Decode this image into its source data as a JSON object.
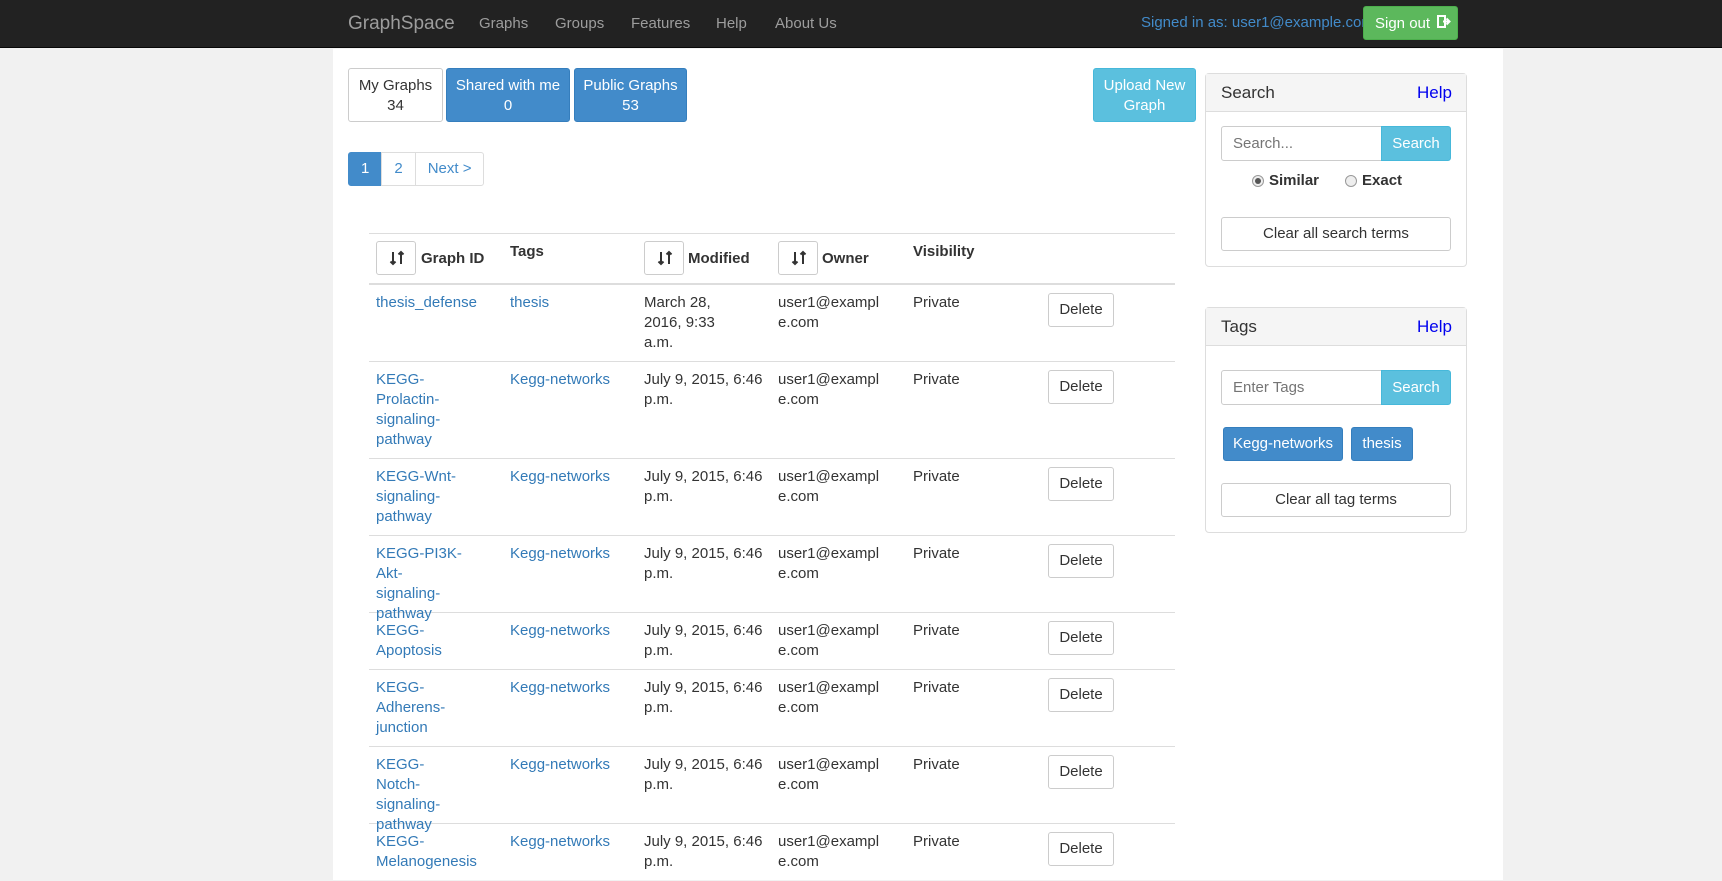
{
  "navbar": {
    "brand": "GraphSpace",
    "links": [
      "Graphs",
      "Groups",
      "Features",
      "Help",
      "About Us"
    ],
    "signed_in": "Signed in as: user1@example.com",
    "sign_out": "Sign out",
    "sign_out_icon": "sign-out-icon"
  },
  "tabs": {
    "my_graphs": {
      "label": "My Graphs",
      "count": "34"
    },
    "shared": {
      "label": "Shared with me",
      "count": "0"
    },
    "public": {
      "label": "Public Graphs",
      "count": "53"
    }
  },
  "upload": {
    "line1": "Upload New",
    "line2": "Graph"
  },
  "pagination": {
    "pages": [
      "1",
      "2"
    ],
    "next": "Next >",
    "active": "1"
  },
  "table": {
    "headers": {
      "graph_id": "Graph ID",
      "tags": "Tags",
      "modified": "Modified",
      "owner": "Owner",
      "visibility": "Visibility"
    },
    "sort_icon": "sort-icon",
    "rows": [
      {
        "graph_id": "thesis_defense",
        "tag": "thesis",
        "modified": "March 28, 2016, 9:33 a.m.",
        "owner": "user1@example.com",
        "visibility": "Private",
        "action": "Delete"
      },
      {
        "graph_id": "KEGG-Prolactin-signaling-pathway",
        "tag": "Kegg-networks",
        "modified": "July 9, 2015, 6:46 p.m.",
        "owner": "user1@example.com",
        "visibility": "Private",
        "action": "Delete"
      },
      {
        "graph_id": "KEGG-Wnt-signaling-pathway",
        "tag": "Kegg-networks",
        "modified": "July 9, 2015, 6:46 p.m.",
        "owner": "user1@example.com",
        "visibility": "Private",
        "action": "Delete"
      },
      {
        "graph_id": "KEGG-PI3K-Akt-signaling-pathway",
        "tag": "Kegg-networks",
        "modified": "July 9, 2015, 6:46 p.m.",
        "owner": "user1@example.com",
        "visibility": "Private",
        "action": "Delete"
      },
      {
        "graph_id": "KEGG-Apoptosis",
        "tag": "Kegg-networks",
        "modified": "July 9, 2015, 6:46 p.m.",
        "owner": "user1@example.com",
        "visibility": "Private",
        "action": "Delete"
      },
      {
        "graph_id": "KEGG-Adherens-junction",
        "tag": "Kegg-networks",
        "modified": "July 9, 2015, 6:46 p.m.",
        "owner": "user1@example.com",
        "visibility": "Private",
        "action": "Delete"
      },
      {
        "graph_id": "KEGG-Notch-signaling-pathway",
        "tag": "Kegg-networks",
        "modified": "July 9, 2015, 6:46 p.m.",
        "owner": "user1@example.com",
        "visibility": "Private",
        "action": "Delete"
      },
      {
        "graph_id": "KEGG-Melanogenesis",
        "tag": "Kegg-networks",
        "modified": "July 9, 2015, 6:46 p.m.",
        "owner": "user1@example.com",
        "visibility": "Private",
        "action": "Delete"
      }
    ]
  },
  "search_panel": {
    "title": "Search",
    "help": "Help",
    "placeholder": "Search...",
    "button": "Search",
    "radio_similar": "Similar",
    "radio_exact": "Exact",
    "selected": "Similar",
    "clear": "Clear all search terms"
  },
  "tags_panel": {
    "title": "Tags",
    "help": "Help",
    "placeholder": "Enter Tags",
    "button": "Search",
    "chips": [
      "Kegg-networks",
      "thesis"
    ],
    "clear": "Clear all tag terms"
  },
  "colors": {
    "navbar": "#222222",
    "primary": "#428bca",
    "success": "#5cb85c",
    "info": "#5bc0de",
    "link": "#337ab7"
  }
}
